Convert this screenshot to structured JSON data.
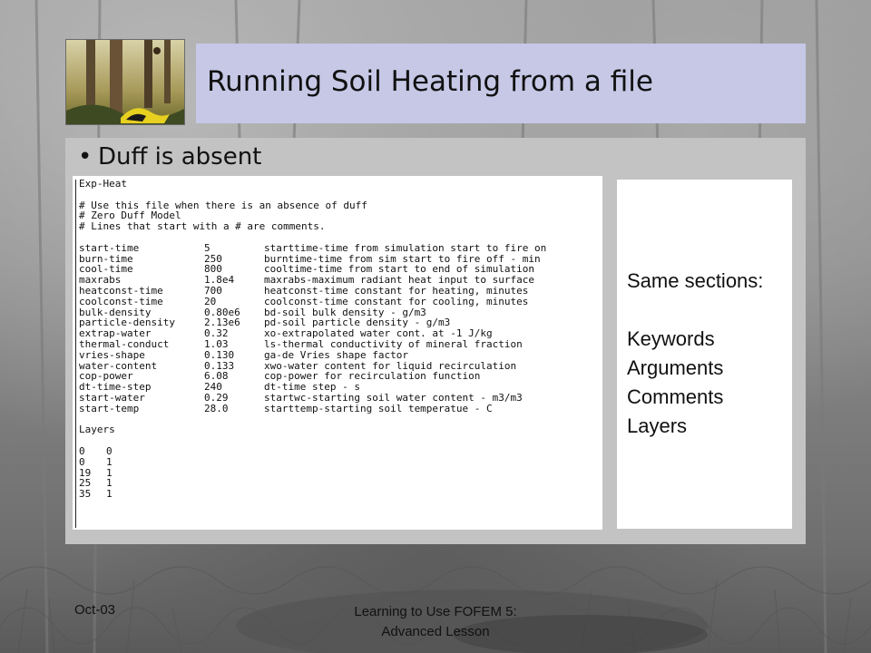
{
  "slide": {
    "title": "Running Soil Heating from a file",
    "bullet": "Duff is absent"
  },
  "code": {
    "header": "Exp-Heat",
    "comments": [
      "# Use this file when there is an absence of duff",
      "# Zero Duff Model",
      "# Lines that start with a # are comments."
    ],
    "params": [
      {
        "key": "start-time",
        "value": "5",
        "comment": "starttime-time from simulation start to fire on"
      },
      {
        "key": "burn-time",
        "value": "250",
        "comment": "burntime-time from sim start to fire off - min"
      },
      {
        "key": "cool-time",
        "value": "800",
        "comment": "cooltime-time from start to end of simulation"
      },
      {
        "key": "maxrabs",
        "value": "1.8e4",
        "comment": "maxrabs-maximum radiant heat input to surface"
      },
      {
        "key": "heatconst-time",
        "value": "700",
        "comment": "heatconst-time constant for heating, minutes"
      },
      {
        "key": "coolconst-time",
        "value": "20",
        "comment": "coolconst-time constant for cooling, minutes"
      },
      {
        "key": "bulk-density",
        "value": "0.80e6",
        "comment": "bd-soil bulk density - g/m3"
      },
      {
        "key": "particle-density",
        "value": "2.13e6",
        "comment": "pd-soil particle density - g/m3"
      },
      {
        "key": "extrap-water",
        "value": "0.32",
        "comment": "xo-extrapolated water cont. at -1 J/kg"
      },
      {
        "key": "thermal-conduct",
        "value": "1.03",
        "comment": "ls-thermal conductivity of mineral fraction"
      },
      {
        "key": "vries-shape",
        "value": "0.130",
        "comment": "ga-de Vries shape factor"
      },
      {
        "key": "water-content",
        "value": "0.133",
        "comment": "xwo-water content for liquid recirculation"
      },
      {
        "key": "cop-power",
        "value": "6.08",
        "comment": "cop-power for recirculation function"
      },
      {
        "key": "dt-time-step",
        "value": "240",
        "comment": "dt-time step - s"
      },
      {
        "key": "start-water",
        "value": "0.29",
        "comment": "startwc-starting soil water content - m3/m3"
      },
      {
        "key": "start-temp",
        "value": "28.0",
        "comment": "starttemp-starting soil temperatue - C"
      }
    ],
    "layers_label": "Layers",
    "layers": [
      {
        "a": "0",
        "b": "0"
      },
      {
        "a": "0",
        "b": "1"
      },
      {
        "a": "19",
        "b": "1"
      },
      {
        "a": "25",
        "b": "1"
      },
      {
        "a": "35",
        "b": "1"
      }
    ]
  },
  "side": {
    "heading": "Same sections:",
    "items": [
      "Keywords",
      "Arguments",
      "Comments",
      "Layers"
    ]
  },
  "footer": {
    "date": "Oct-03",
    "line1": "Learning to Use FOFEM 5:",
    "line2": "Advanced Lesson"
  },
  "colors": {
    "title_bar": "#c6c8e6",
    "content_panel": "#c3c3c3"
  }
}
